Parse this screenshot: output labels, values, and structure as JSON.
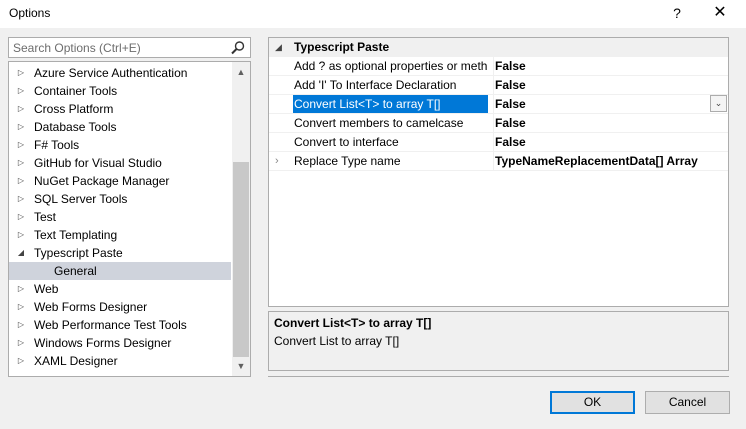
{
  "window": {
    "title": "Options",
    "help_glyph": "?",
    "close_glyph": "✕"
  },
  "search": {
    "placeholder": "Search Options (Ctrl+E)"
  },
  "tree": {
    "items": [
      {
        "label": "Azure Service Authentication",
        "arrow": "▷"
      },
      {
        "label": "Container Tools",
        "arrow": "▷"
      },
      {
        "label": "Cross Platform",
        "arrow": "▷"
      },
      {
        "label": "Database Tools",
        "arrow": "▷"
      },
      {
        "label": "F# Tools",
        "arrow": "▷"
      },
      {
        "label": "GitHub for Visual Studio",
        "arrow": "▷"
      },
      {
        "label": "NuGet Package Manager",
        "arrow": "▷"
      },
      {
        "label": "SQL Server Tools",
        "arrow": "▷"
      },
      {
        "label": "Test",
        "arrow": "▷"
      },
      {
        "label": "Text Templating",
        "arrow": "▷"
      },
      {
        "label": "Typescript Paste",
        "arrow": "◢"
      },
      {
        "label": "General",
        "arrow": ""
      },
      {
        "label": "Web",
        "arrow": "▷"
      },
      {
        "label": "Web Forms Designer",
        "arrow": "▷"
      },
      {
        "label": "Web Performance Test Tools",
        "arrow": "▷"
      },
      {
        "label": "Windows Forms Designer",
        "arrow": "▷"
      },
      {
        "label": "XAML Designer",
        "arrow": "▷"
      }
    ],
    "scroll_up": "▲",
    "scroll_down": "▼"
  },
  "grid": {
    "category": "Typescript Paste",
    "category_arrow": "◢",
    "properties": [
      {
        "name": "Add ? as optional properties or methods",
        "value": "False",
        "expander": ""
      },
      {
        "name": "Add 'I' To Interface Declaration",
        "value": "False",
        "expander": ""
      },
      {
        "name": "Convert List<T> to array T[]",
        "value": "False",
        "expander": ""
      },
      {
        "name": "Convert members to camelcase",
        "value": "False",
        "expander": ""
      },
      {
        "name": "Convert to interface",
        "value": "False",
        "expander": ""
      },
      {
        "name": "Replace Type name",
        "value": "TypeNameReplacementData[] Array",
        "expander": "›"
      }
    ],
    "dropdown_glyph": "⌄"
  },
  "description": {
    "title": "Convert List<T> to array T[]",
    "text": "Convert List to array T[]"
  },
  "buttons": {
    "ok": "OK",
    "cancel": "Cancel"
  }
}
